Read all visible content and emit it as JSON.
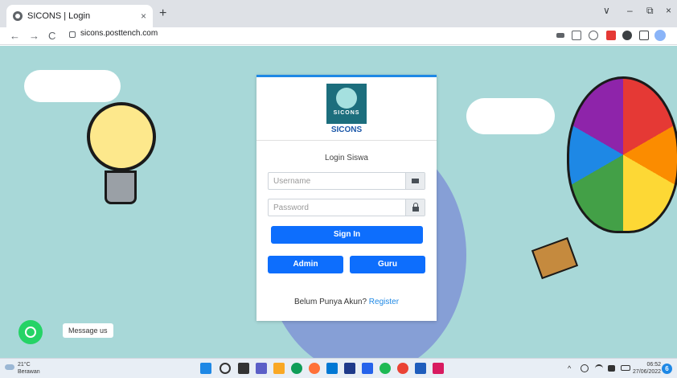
{
  "browser": {
    "tab_title": "SICONS | Login",
    "tab_close": "×",
    "new_tab": "+",
    "url": "sicons.posttench.com",
    "nav": {
      "back": "←",
      "forward": "→",
      "reload": "C"
    },
    "window": {
      "minimize": "–",
      "restore": "⧉",
      "close": "×",
      "dropdown": "∨"
    }
  },
  "login": {
    "logo_text": "SICONS",
    "brand": "SICONS",
    "title": "Login Siswa",
    "username_placeholder": "Username",
    "password_placeholder": "Password",
    "sign_in_label": "Sign In",
    "admin_label": "Admin",
    "guru_label": "Guru",
    "register_prompt": "Belum Punya Akun?",
    "register_link": "Register"
  },
  "messenger": {
    "label": "Message us"
  },
  "taskbar": {
    "weather_temp": "21°C",
    "weather_desc": "Berawan",
    "time": "06:52",
    "date": "27/06/2022",
    "notif_count": "6"
  },
  "colors": {
    "accent": "#0d6efd",
    "page_bg": "#a8d8d8",
    "card_border": "#1e88e5",
    "logo_bg": "#1c6e7d"
  }
}
